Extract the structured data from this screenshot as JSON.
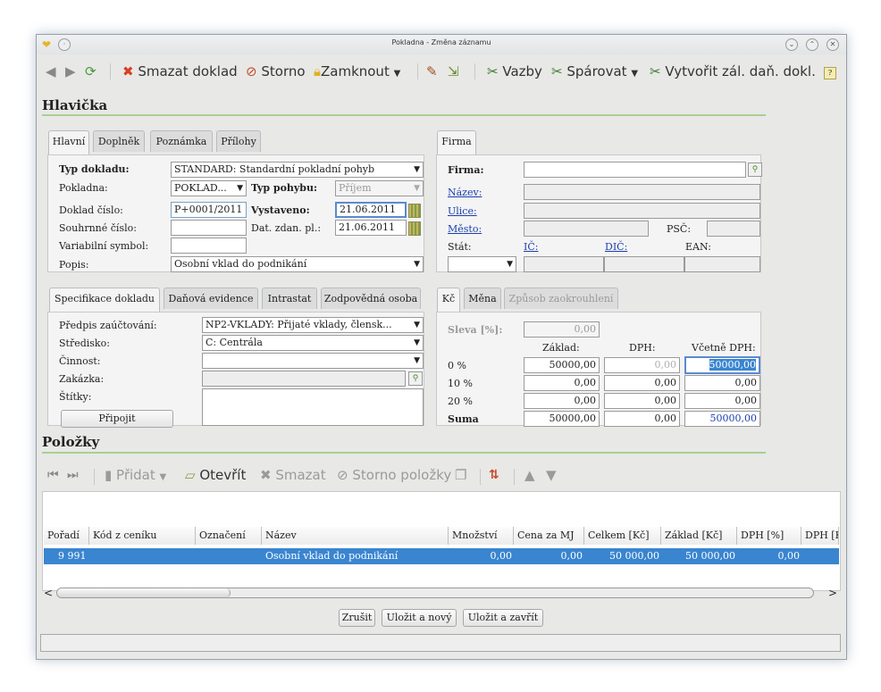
{
  "window": {
    "title": "Pokladna - Změna záznamu"
  },
  "toolbar": {
    "delete": "Smazat doklad",
    "storno": "Storno",
    "lock": "Zamknout",
    "links": "Vazby",
    "pair": "Spárovat",
    "create_tax": "Vytvořit zál. daň. dokl."
  },
  "header": {
    "title": "Hlavička",
    "tabs": [
      "Hlavní",
      "Doplněk",
      "Poznámka",
      "Přílohy"
    ],
    "typ_dokladu_label": "Typ dokladu:",
    "typ_dokladu": "STANDARD: Standardní pokladní pohyb",
    "pokladna_label": "Pokladna:",
    "pokladna": "POKLAD...",
    "typ_pohybu_label": "Typ pohybu:",
    "typ_pohybu": "Příjem",
    "doklad_cislo_label": "Doklad číslo:",
    "doklad_cislo": "P+0001/2011",
    "vystaveno_label": "Vystaveno:",
    "vystaveno": "21.06.2011",
    "souhrnne_label": "Souhrnné číslo:",
    "dat_zdan_label": "Dat. zdan. pl.:",
    "dat_zdan": "21.06.2011",
    "varsym_label": "Variabilní symbol:",
    "popis_label": "Popis:",
    "popis": "Osobní vklad do podnikání"
  },
  "firma": {
    "tab": "Firma",
    "firma_label": "Firma:",
    "nazev_label": "Název:",
    "ulice_label": "Ulice:",
    "mesto_label": "Město:",
    "psc_label": "PSČ:",
    "stat_label": "Stát:",
    "ic_label": "IČ:",
    "dic_label": "DIČ:",
    "ean_label": "EAN:"
  },
  "spec": {
    "tabs": [
      "Specifikace dokladu",
      "Daňová evidence",
      "Intrastat",
      "Zodpovědná osoba"
    ],
    "predpis_label": "Předpis zaúčtování:",
    "predpis": "NP2-VKLADY: Přijaté vklady, člensk...",
    "stredisko_label": "Středisko:",
    "stredisko": "C: Centrála",
    "cinnost_label": "Činnost:",
    "zakazka_label": "Zakázka:",
    "stitky_label": "Štítky:",
    "pripojit": "Připojit"
  },
  "kc": {
    "tabs": [
      "Kč",
      "Měna",
      "Způsob zaokrouhlení"
    ],
    "sleva_label": "Sleva [%]:",
    "sleva": "0,00",
    "col_zaklad": "Základ:",
    "col_dph": "DPH:",
    "col_vcetne": "Včetně DPH:",
    "rows": [
      {
        "label": "0 %",
        "zaklad": "50000,00",
        "dph": "0,00",
        "vcetne": "50000,00"
      },
      {
        "label": "10 %",
        "zaklad": "0,00",
        "dph": "0,00",
        "vcetne": "0,00"
      },
      {
        "label": "20 %",
        "zaklad": "0,00",
        "dph": "0,00",
        "vcetne": "0,00"
      }
    ],
    "suma_label": "Suma",
    "suma_zaklad": "50000,00",
    "suma_dph": "0,00",
    "suma_vcetne": "50000,00"
  },
  "items": {
    "title": "Položky",
    "add": "Přidat",
    "open": "Otevřít",
    "delete": "Smazat",
    "storno": "Storno položky",
    "columns": [
      "Pořadí",
      "Kód z ceníku",
      "Označení",
      "Název",
      "Množství",
      "Cena za MJ",
      "Celkem [Kč]",
      "Základ [Kč]",
      "DPH [%]",
      "DPH [K"
    ],
    "row": {
      "poradi": "9 991",
      "kod": "",
      "oznaceni": "",
      "nazev": "Osobní vklad do podnikání",
      "mnozstvi": "0,00",
      "cena": "0,00",
      "celkem": "50 000,00",
      "zaklad": "50 000,00",
      "dph": "0,00"
    }
  },
  "footer": {
    "cancel": "Zrušit",
    "save_new": "Uložit a nový",
    "save_close": "Uložit a zavřít"
  },
  "colors": {
    "selection": "#3a85d0",
    "link": "#1a3fb0",
    "accent_line": "#a8d090"
  }
}
